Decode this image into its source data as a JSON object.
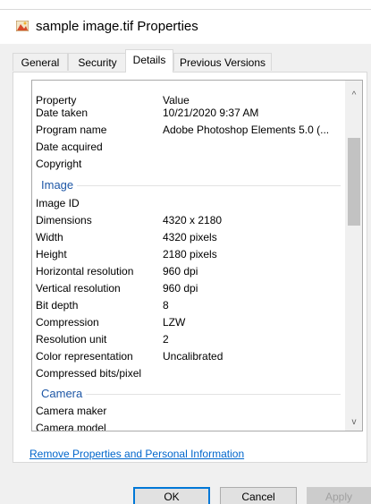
{
  "window": {
    "title": "sample image.tif Properties"
  },
  "tabs": [
    {
      "label": "General"
    },
    {
      "label": "Security"
    },
    {
      "label": "Details"
    },
    {
      "label": "Previous Versions"
    }
  ],
  "details": {
    "header": {
      "property": "Property",
      "value": "Value"
    },
    "rows_top": [
      {
        "property": "Date taken",
        "value": "10/21/2020 9:37 AM"
      },
      {
        "property": "Program name",
        "value": "Adobe Photoshop Elements 5.0 (..."
      },
      {
        "property": "Date acquired",
        "value": ""
      },
      {
        "property": "Copyright",
        "value": ""
      }
    ],
    "group_image": "Image",
    "rows_image": [
      {
        "property": "Image ID",
        "value": ""
      },
      {
        "property": "Dimensions",
        "value": "4320 x 2180"
      },
      {
        "property": "Width",
        "value": "4320 pixels"
      },
      {
        "property": "Height",
        "value": "2180 pixels"
      },
      {
        "property": "Horizontal resolution",
        "value": "960 dpi"
      },
      {
        "property": "Vertical resolution",
        "value": "960 dpi"
      },
      {
        "property": "Bit depth",
        "value": "8"
      },
      {
        "property": "Compression",
        "value": "LZW"
      },
      {
        "property": "Resolution unit",
        "value": "2"
      },
      {
        "property": "Color representation",
        "value": "Uncalibrated"
      },
      {
        "property": "Compressed bits/pixel",
        "value": ""
      }
    ],
    "group_camera": "Camera",
    "rows_camera": [
      {
        "property": "Camera maker",
        "value": ""
      },
      {
        "property": "Camera model",
        "value": ""
      }
    ]
  },
  "scrollbar": {
    "up_icon": "chevron-up-icon",
    "down_icon": "chevron-down-icon",
    "up_glyph": "^",
    "down_glyph": "v"
  },
  "links": {
    "remove_properties": "Remove Properties and Personal Information"
  },
  "buttons": {
    "ok": "OK",
    "cancel": "Cancel",
    "apply": "Apply"
  },
  "colors": {
    "group_header": "#1e57a6",
    "link": "#0066cc",
    "default_button_border": "#0078d7"
  }
}
